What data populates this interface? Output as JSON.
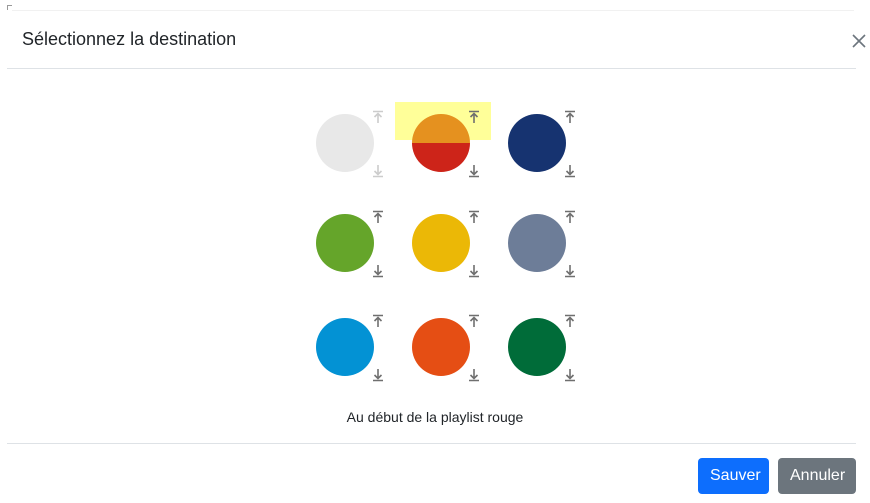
{
  "modal": {
    "title": "Sélectionnez la destination",
    "status_text": "Au début de la playlist rouge"
  },
  "icons": {
    "close": "close-icon",
    "up": "move-to-top-icon",
    "down": "move-to-bottom-icon"
  },
  "destinations": [
    {
      "name": "white",
      "color": "#e8e8e8",
      "faded": true
    },
    {
      "name": "red",
      "color_top": "#e5911f",
      "color_bottom": "#cd2419",
      "selected": true
    },
    {
      "name": "navy",
      "color": "#163370"
    },
    {
      "name": "green",
      "color": "#65a52a"
    },
    {
      "name": "yellow",
      "color": "#ebb806"
    },
    {
      "name": "grey-blue",
      "color": "#6d7d98"
    },
    {
      "name": "light-blue",
      "color": "#0392d4"
    },
    {
      "name": "orange",
      "color": "#e54e14"
    },
    {
      "name": "dark-green",
      "color": "#006c39"
    }
  ],
  "colors": {
    "highlight": "#ffff99",
    "icon": "#6f6f6f",
    "primary": "#0d6efd",
    "secondary": "#6c757d"
  },
  "footer": {
    "save_label": "Sauver",
    "cancel_label": "Annuler"
  }
}
